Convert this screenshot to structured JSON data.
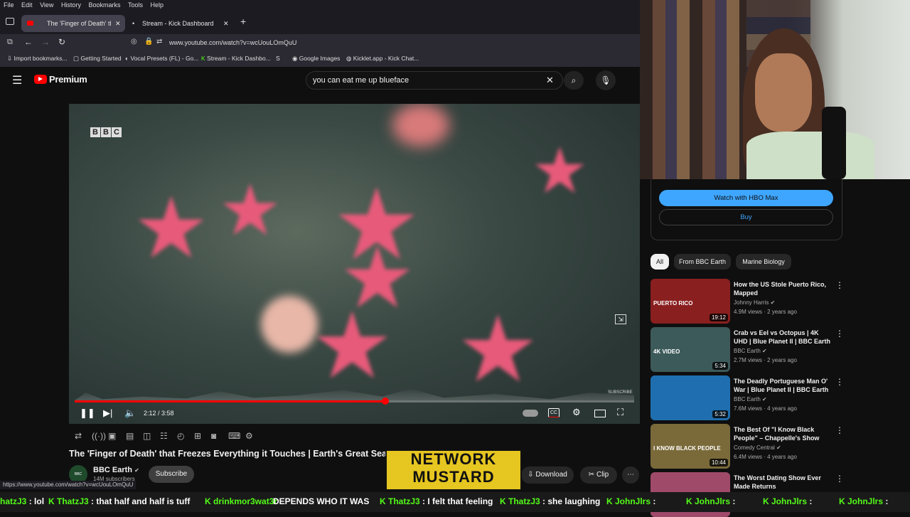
{
  "menu": [
    "File",
    "Edit",
    "View",
    "History",
    "Bookmarks",
    "Tools",
    "Help"
  ],
  "tabs": [
    {
      "label": "The 'Finger of Death' that F"
    },
    {
      "label": "Stream - Kick Dashboard"
    }
  ],
  "url": "www.youtube.com/watch?v=wcUouLOmQuU",
  "bookmarks": [
    "Import bookmarks...",
    "Getting Started",
    "Vocal Presets (FL) - Go...",
    "Stream - Kick Dashbo...",
    "Google Images",
    "Kicklet.app - Kick Chat..."
  ],
  "youtube": {
    "logo_text": "Premium",
    "search_value": "you can eat me up blueface",
    "video_watermark": "BBC",
    "subscribe_watermark": "SUBSCRIBE",
    "time": "2:12 / 3:58",
    "progress": 0.555,
    "title": "The 'Finger of Death' that Freezes Everything it Touches | Earth's Great Seas",
    "channel": "BBC Earth",
    "subscribers": "14M subscribers",
    "subscribe_label": "Subscribe",
    "download_label": "Download",
    "clip_label": "Clip",
    "hbo_label": "Watch with HBO Max",
    "buy_label": "Buy",
    "chips": [
      "All",
      "From BBC Earth",
      "Marine Biology"
    ],
    "recommended": [
      {
        "title": "How the US Stole Puerto Rico, Mapped",
        "channel": "Johnny Harris",
        "meta": "4.9M views · 2 years ago",
        "duration": "19:12",
        "thumb_text": "PUERTO RICO",
        "color": "#8a1f1f"
      },
      {
        "title": "Crab vs Eel vs Octopus | 4K UHD | Blue Planet II | BBC Earth",
        "channel": "BBC Earth",
        "meta": "2.7M views · 2 years ago",
        "duration": "5:34",
        "thumb_text": "4K VIDEO",
        "color": "#3d5a5a"
      },
      {
        "title": "The Deadly Portuguese Man O' War | Blue Planet II | BBC Earth",
        "channel": "BBC Earth",
        "meta": "7.6M views · 4 years ago",
        "duration": "5:32",
        "thumb_text": "",
        "color": "#1f6fb0"
      },
      {
        "title": "The Best Of \"I Know Black People\" – Chappelle's Show",
        "channel": "Comedy Central",
        "meta": "6.4M views · 4 years ago",
        "duration": "10:44",
        "thumb_text": "I KNOW BLACK PEOPLE",
        "color": "#7a6a3a"
      },
      {
        "title": "The Worst Dating Show Ever Made Returns",
        "channel": "",
        "meta": "",
        "duration": "",
        "thumb_text": "",
        "color": "#a04a6a"
      }
    ]
  },
  "overlay": {
    "brand_line1": "NETWORK",
    "brand_line2": "MUSTARD",
    "status_url": "https://www.youtube.com/watch?v=wcUouLOmQuU",
    "ticker": [
      {
        "user": "hatzJ3",
        "msg": ": lol"
      },
      {
        "user": "ThatzJ3",
        "msg": ": that half and half is tuff"
      },
      {
        "user": "drinkmor3wat3r",
        "msg": ""
      },
      {
        "user": "",
        "msg": "DEPENDS WHO IT WAS"
      },
      {
        "user": "ThatzJ3",
        "msg": ": I felt that feeling"
      },
      {
        "user": "ThatzJ3",
        "msg": ": she laughing"
      },
      {
        "user": "JohnJlrs",
        "msg": ":"
      },
      {
        "user": "JohnJlrs",
        "msg": ":"
      },
      {
        "user": "JohnJlrs",
        "msg": ":"
      },
      {
        "user": "JohnJlrs",
        "msg": ":"
      }
    ]
  }
}
